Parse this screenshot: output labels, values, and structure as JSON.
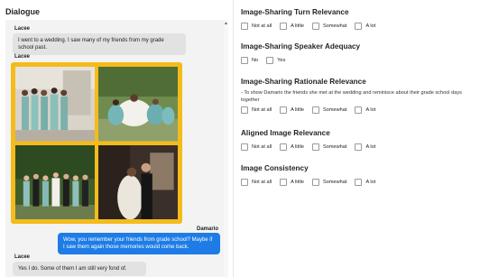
{
  "dialogue": {
    "title": "Dialogue",
    "messages": [
      {
        "speaker": "Lacee",
        "text": "I went to a wedding. I saw many of my friends from my grade school past."
      },
      {
        "speaker": "Lacee",
        "image": "wedding-photo-collage"
      },
      {
        "speaker": "Damario",
        "text": "Wow, you remember your friends from grade school? Maybe if I saw them again those memories would come back."
      },
      {
        "speaker": "Lacee",
        "text": "Yes I do. Some of them I am still very fond of."
      }
    ]
  },
  "evaluation": {
    "turn_relevance": {
      "title": "Image-Sharing Turn Relevance",
      "options": [
        "Not at all",
        "A little",
        "Somewhat",
        "A lot"
      ]
    },
    "speaker_adequacy": {
      "title": "Image-Sharing Speaker Adequacy",
      "options": [
        "No",
        "Yes"
      ]
    },
    "rationale_relevance": {
      "title": "Image-Sharing Rationale Relevance",
      "rationale": "- To show Damario the friends she met at the wedding and reminisce about their grade school days together",
      "options": [
        "Not at all",
        "A little",
        "Somewhat",
        "A lot"
      ]
    },
    "aligned_image_relevance": {
      "title": "Aligned Image Relevance",
      "options": [
        "Not at all",
        "A little",
        "Somewhat",
        "A lot"
      ]
    },
    "image_consistency": {
      "title": "Image Consistency",
      "options": [
        "Not at all",
        "A little",
        "Somewhat",
        "A lot"
      ]
    }
  },
  "colors": {
    "frame": "#f4bb1c",
    "bubble_user": "#1e7ce6",
    "bubble_other": "#e2e2e3"
  }
}
